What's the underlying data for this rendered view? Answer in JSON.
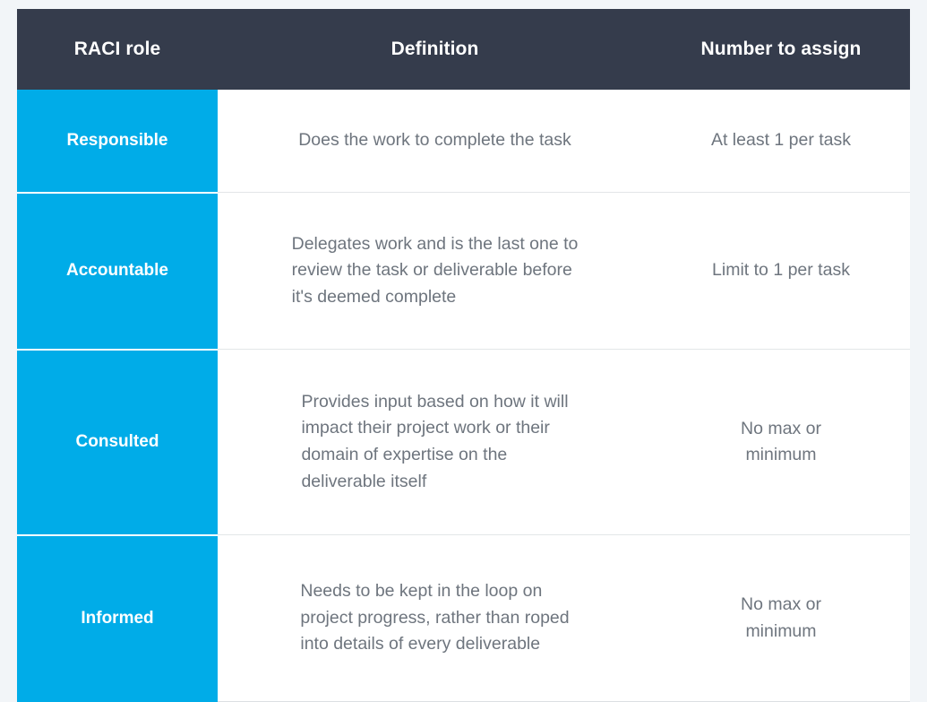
{
  "table": {
    "columns": [
      {
        "key": "role",
        "label": "RACI role"
      },
      {
        "key": "def",
        "label": "Definition"
      },
      {
        "key": "number",
        "label": "Number to assign"
      }
    ],
    "rows": [
      {
        "role": "Responsible",
        "definition_lines": [
          "Does the work to complete the task"
        ],
        "number_lines": [
          "At least 1 per task"
        ]
      },
      {
        "role": "Accountable",
        "definition_lines": [
          "Delegates work and is the last one to",
          "review the task or deliverable before",
          "it's deemed complete"
        ],
        "number_lines": [
          "Limit to 1 per task"
        ]
      },
      {
        "role": "Consulted",
        "definition_lines": [
          "Provides input based on how it will",
          "impact their project work or their",
          "domain of expertise on the",
          "deliverable itself"
        ],
        "number_lines": [
          "No max or",
          "minimum"
        ]
      },
      {
        "role": "Informed",
        "definition_lines": [
          "Needs to be kept in the loop on",
          "project progress, rather than roped",
          "into details of every deliverable"
        ],
        "number_lines": [
          "No max or",
          "minimum"
        ]
      }
    ]
  },
  "colors": {
    "header_background": "#353c4c",
    "role_background": "#00ace8",
    "page_background": "#f2f5f8",
    "body_text": "#6e757e",
    "row_divider": "#e3e6e8"
  }
}
